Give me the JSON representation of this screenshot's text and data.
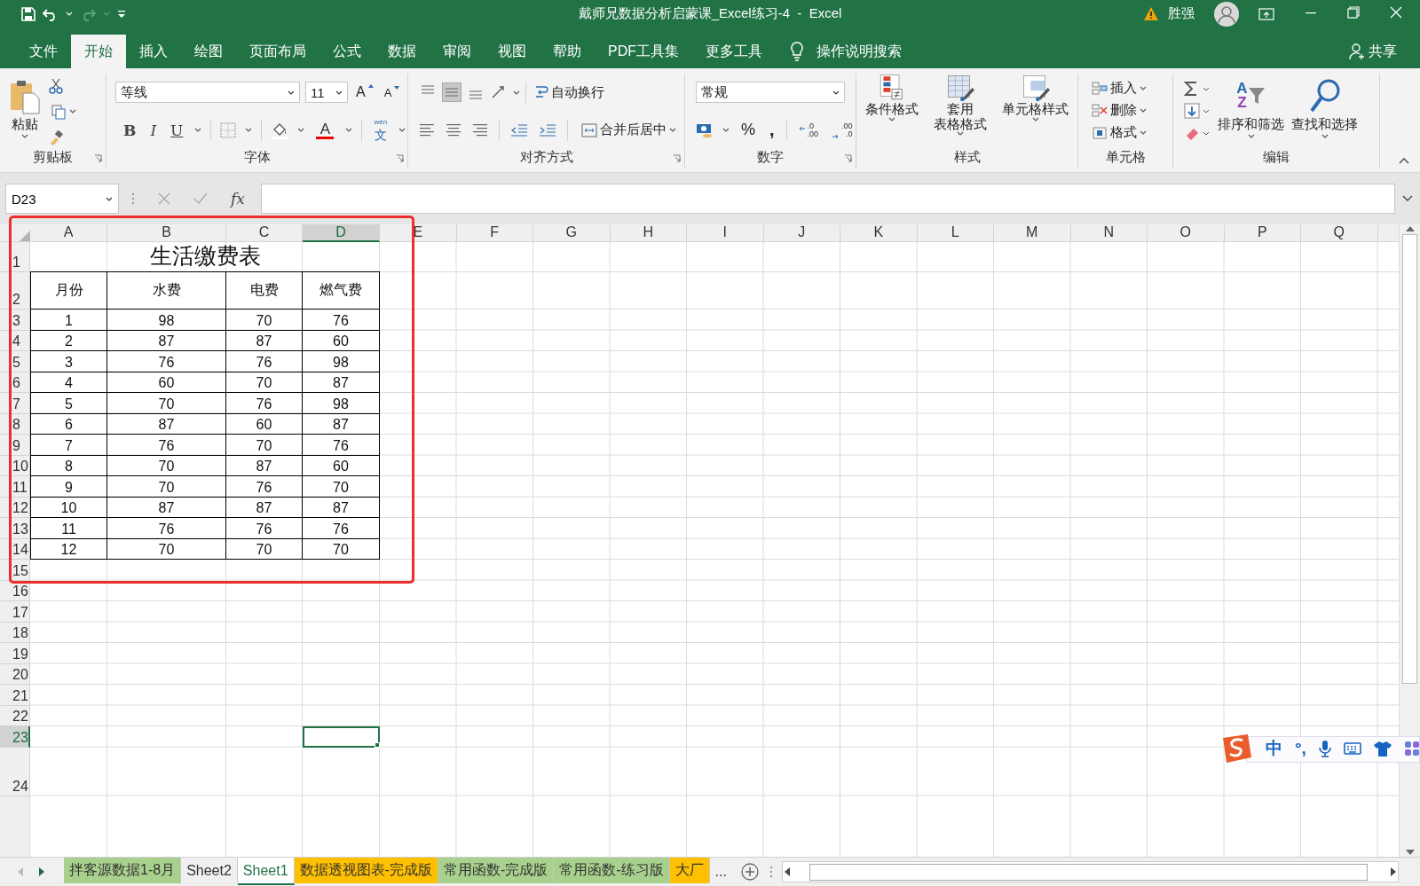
{
  "window": {
    "title": "戴师兄数据分析启蒙课_Excel练习-4  -  Excel",
    "user": "胜强"
  },
  "menu_tabs": [
    {
      "label": "文件",
      "selected": false
    },
    {
      "label": "开始",
      "selected": true
    },
    {
      "label": "插入",
      "selected": false
    },
    {
      "label": "绘图",
      "selected": false
    },
    {
      "label": "页面布局",
      "selected": false
    },
    {
      "label": "公式",
      "selected": false
    },
    {
      "label": "数据",
      "selected": false
    },
    {
      "label": "审阅",
      "selected": false
    },
    {
      "label": "视图",
      "selected": false
    },
    {
      "label": "帮助",
      "selected": false
    },
    {
      "label": "PDF工具集",
      "selected": false
    },
    {
      "label": "更多工具",
      "selected": false
    }
  ],
  "tell_me": "操作说明搜索",
  "share": "共享",
  "ribbon": [
    {
      "kind": "clipboard",
      "label": "剪贴板",
      "paste": "粘贴"
    },
    {
      "kind": "font",
      "label": "字体",
      "font_name": "等线",
      "font_size": "11",
      "grow": "A",
      "shrink": "A",
      "bold": "B",
      "italic": "I",
      "underline": "U",
      "font_color": "A",
      "phonetic": "wén",
      "phonetic_char": "文"
    },
    {
      "kind": "alignment",
      "label": "对齐方式",
      "vertical_align": [
        {
          "selected": false
        },
        {
          "selected": true
        },
        {
          "selected": false
        }
      ],
      "wrap_text": "自动换行",
      "merge": "合并后居中"
    },
    {
      "kind": "number",
      "label": "数字",
      "format": "常规",
      "percent": "%",
      "comma": ",",
      "increase_decimal": [
        ".0",
        ".00"
      ],
      "decrease_decimal": [
        ".00",
        ".0"
      ]
    },
    {
      "kind": "styles",
      "label": "样式",
      "buttons": [
        {
          "lines": [
            "条件格式"
          ]
        },
        {
          "lines": [
            "套用",
            "表格格式"
          ]
        },
        {
          "lines": [
            "单元格样式"
          ]
        }
      ]
    },
    {
      "kind": "cells",
      "label": "单元格",
      "buttons": [
        "插入",
        "删除",
        "格式"
      ]
    },
    {
      "kind": "editing",
      "label": "编辑",
      "sort_letters": [
        "A",
        "Z"
      ],
      "buttons": [
        "排序和筛选",
        "查找和选择"
      ]
    }
  ],
  "formula_bar": {
    "name_box": "D23",
    "function_label": "fx"
  },
  "sheet": {
    "columns": [
      {
        "label": "A",
        "selected": false
      },
      {
        "label": "B",
        "selected": false
      },
      {
        "label": "C",
        "selected": false
      },
      {
        "label": "D",
        "selected": true
      },
      {
        "label": "E",
        "selected": false
      },
      {
        "label": "F",
        "selected": false
      },
      {
        "label": "G",
        "selected": false
      },
      {
        "label": "H",
        "selected": false
      },
      {
        "label": "I",
        "selected": false
      },
      {
        "label": "J",
        "selected": false
      },
      {
        "label": "K",
        "selected": false
      },
      {
        "label": "L",
        "selected": false
      },
      {
        "label": "M",
        "selected": false
      },
      {
        "label": "N",
        "selected": false
      },
      {
        "label": "O",
        "selected": false
      },
      {
        "label": "P",
        "selected": false
      },
      {
        "label": "Q",
        "selected": false
      }
    ],
    "rows": [
      {
        "label": "1",
        "selected": false
      },
      {
        "label": "2",
        "selected": false
      },
      {
        "label": "3",
        "selected": false
      },
      {
        "label": "4",
        "selected": false
      },
      {
        "label": "5",
        "selected": false
      },
      {
        "label": "6",
        "selected": false
      },
      {
        "label": "7",
        "selected": false
      },
      {
        "label": "8",
        "selected": false
      },
      {
        "label": "9",
        "selected": false
      },
      {
        "label": "10",
        "selected": false
      },
      {
        "label": "11",
        "selected": false
      },
      {
        "label": "12",
        "selected": false
      },
      {
        "label": "13",
        "selected": false
      },
      {
        "label": "14",
        "selected": false
      },
      {
        "label": "15",
        "selected": false
      },
      {
        "label": "16",
        "selected": false
      },
      {
        "label": "17",
        "selected": false
      },
      {
        "label": "18",
        "selected": false
      },
      {
        "label": "19",
        "selected": false
      },
      {
        "label": "20",
        "selected": false
      },
      {
        "label": "21",
        "selected": false
      },
      {
        "label": "22",
        "selected": false
      },
      {
        "label": "23",
        "selected": true
      },
      {
        "label": "24",
        "selected": false
      }
    ],
    "title": "生活缴费表",
    "headers": [
      "月份",
      "水费",
      "电费",
      "燃气费"
    ],
    "data": [
      [
        "1",
        "98",
        "70",
        "76"
      ],
      [
        "2",
        "87",
        "87",
        "60"
      ],
      [
        "3",
        "76",
        "76",
        "98"
      ],
      [
        "4",
        "60",
        "70",
        "87"
      ],
      [
        "5",
        "70",
        "76",
        "98"
      ],
      [
        "6",
        "87",
        "60",
        "87"
      ],
      [
        "7",
        "76",
        "70",
        "76"
      ],
      [
        "8",
        "70",
        "87",
        "60"
      ],
      [
        "9",
        "70",
        "76",
        "70"
      ],
      [
        "10",
        "87",
        "87",
        "87"
      ],
      [
        "11",
        "76",
        "76",
        "76"
      ],
      [
        "12",
        "70",
        "70",
        "70"
      ]
    ]
  },
  "sheet_tabs": [
    {
      "label": "拌客源数据1-8月",
      "selected": false,
      "color": "#a9d18e"
    },
    {
      "label": "Sheet2",
      "selected": false
    },
    {
      "label": "Sheet1",
      "selected": true
    },
    {
      "label": "数据透视图表-完成版",
      "selected": false,
      "color": "#ffc000"
    },
    {
      "label": "常用函数-完成版",
      "selected": false,
      "color": "#a9d18e"
    },
    {
      "label": "常用函数-练习版",
      "selected": false,
      "color": "#a9d18e"
    },
    {
      "label": "大厂",
      "selected": false,
      "color": "#ffc000"
    }
  ],
  "more_tabs": "...",
  "ime": {
    "mode": "中",
    "punctuation": "°,"
  }
}
